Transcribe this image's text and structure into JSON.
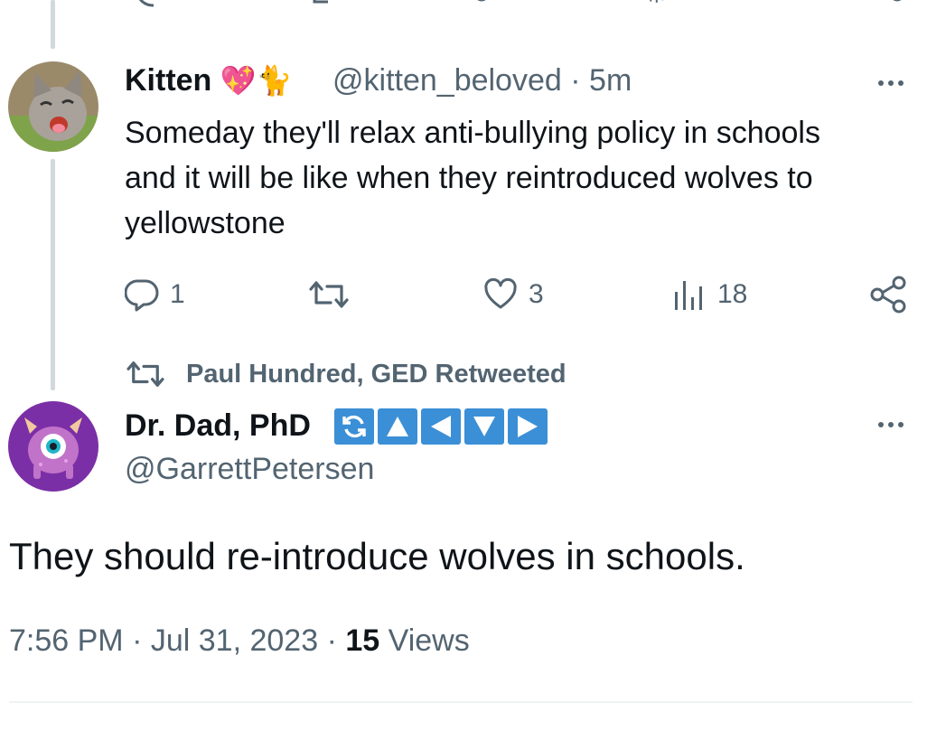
{
  "tweet_reply": {
    "display_name": "Kitten",
    "name_emoji": "💖🐈",
    "handle": "@kitten_beloved",
    "time": "5m",
    "text_lines": [
      "Someday they'll relax anti-bullying policy in schools",
      "and it will be like when they reintroduced wolves to",
      "yellowstone"
    ],
    "reply_count": "1",
    "retweet_count": "",
    "like_count": "3",
    "view_count": "18"
  },
  "retweet_banner": {
    "text": "Paul Hundred, GED Retweeted"
  },
  "main_tweet": {
    "display_name": "Dr. Dad, PhD",
    "handle": "@GarrettPetersen",
    "text": "They should re-introduce wolves in schools.",
    "time": "7:56 PM",
    "date": "Jul 31, 2023",
    "views_count": "15",
    "views_label": "Views",
    "badges": [
      "refresh-icon",
      "triangle-up-icon",
      "triangle-left-icon",
      "triangle-down-icon",
      "triangle-right-icon"
    ]
  },
  "colors": {
    "text": "#0f1419",
    "secondary": "#536471",
    "thread_line": "#cfd9de",
    "badge_blue": "#3b8fd6",
    "avatar_purple": "#7b2fa6"
  }
}
